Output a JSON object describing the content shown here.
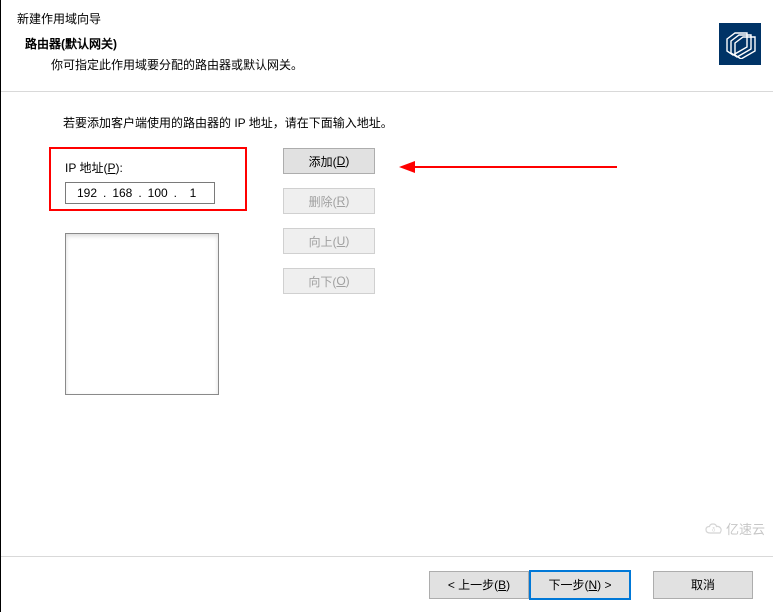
{
  "window": {
    "title": "新建作用域向导"
  },
  "header": {
    "title": "路由器(默认网关)",
    "desc": "你可指定此作用域要分配的路由器或默认网关。",
    "icon": "folders-icon"
  },
  "instruction": "若要添加客户端使用的路由器的 IP 地址，请在下面输入地址。",
  "ip": {
    "label_prefix": "IP 地址(",
    "label_mnemonic": "P",
    "label_suffix": "):",
    "oct1": "192",
    "oct2": "168",
    "oct3": "100",
    "oct4": "1"
  },
  "buttons": {
    "add_prefix": "添加(",
    "add_mnemonic": "D",
    "add_suffix": ")",
    "del_prefix": "删除(",
    "del_mnemonic": "R",
    "del_suffix": ")",
    "up_prefix": "向上(",
    "up_mnemonic": "U",
    "up_suffix": ")",
    "down_prefix": "向下(",
    "down_mnemonic": "O",
    "down_suffix": ")"
  },
  "footer": {
    "back_prefix": "< 上一步(",
    "back_mnemonic": "B",
    "back_suffix": ")",
    "next_prefix": "下一步(",
    "next_mnemonic": "N",
    "next_suffix": ") >",
    "cancel": "取消"
  },
  "watermark": "亿速云",
  "annotation": {
    "arrow_color": "#ff0000"
  }
}
